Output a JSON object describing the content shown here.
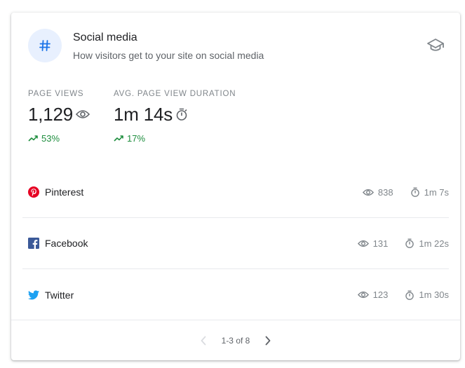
{
  "card": {
    "title": "Social media",
    "subtitle": "How visitors get to your site on social media",
    "header_icon": "hashtag-icon",
    "learn_icon": "school-icon"
  },
  "metrics": {
    "page_views": {
      "label": "PAGE VIEWS",
      "value": "1,129",
      "icon": "eye-icon",
      "trend": "53%",
      "trend_direction": "up"
    },
    "avg_duration": {
      "label": "AVG. PAGE VIEW DURATION",
      "value": "1m 14s",
      "icon": "timer-icon",
      "trend": "17%",
      "trend_direction": "up"
    }
  },
  "rows": [
    {
      "name": "Pinterest",
      "icon": "pinterest-icon",
      "views": "838",
      "duration": "1m 7s"
    },
    {
      "name": "Facebook",
      "icon": "facebook-icon",
      "views": "131",
      "duration": "1m 22s"
    },
    {
      "name": "Twitter",
      "icon": "twitter-icon",
      "views": "123",
      "duration": "1m 30s"
    }
  ],
  "pagination": {
    "text": "1-3 of 8",
    "prev_enabled": false,
    "next_enabled": true
  },
  "colors": {
    "accent": "#1a73e8",
    "accent_bg": "#e8f0fe",
    "trend_up": "#1e8e3e",
    "muted": "#80868b",
    "pinterest": "#e60023",
    "facebook": "#3b5998",
    "twitter": "#1da1f2"
  }
}
